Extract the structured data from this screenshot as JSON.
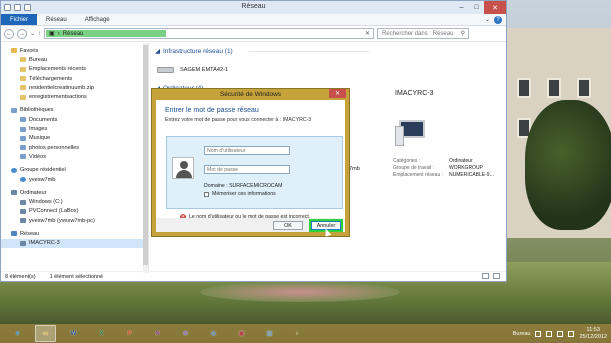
{
  "window": {
    "title": "Réseau"
  },
  "win_controls": {
    "minimize": "–",
    "maximize": "□",
    "close": "✕"
  },
  "ribbon": {
    "tabs": [
      "Fichier",
      "Réseau",
      "Affichage"
    ],
    "help": "?"
  },
  "address": {
    "path": "Réseau",
    "search_placeholder": "Rechercher dans : Réseau"
  },
  "nav": {
    "favorites": {
      "label": "Favoris",
      "items": [
        "Bureau",
        "Emplacements récents",
        "Téléchargements",
        "residentielcreatinuumb.zip",
        "enregistrementsactions"
      ]
    },
    "libraries": {
      "label": "Bibliothèques",
      "items": [
        "Documents",
        "Images",
        "Musique",
        "photos personnelles",
        "Vidéos"
      ]
    },
    "homegroup": {
      "label": "Groupe résidentiel",
      "items": [
        "yvesw7mb"
      ]
    },
    "computer": {
      "label": "Ordinateur",
      "items": [
        "Windows (C:)",
        "PVConnect (LaBox)",
        "yvesw7mb (yvesw7mb-pc)"
      ]
    },
    "network": {
      "label": "Réseau",
      "items": [
        "IMACYRC-3"
      ]
    }
  },
  "content": {
    "sections": [
      {
        "label": "Infrastructure réseau (1)"
      },
      {
        "label": "Ordinateur (4)"
      }
    ],
    "router_label": "SAGEM EMTA42-1",
    "partial_item": "7mb"
  },
  "details": {
    "name": "IMACYRC-3",
    "props": [
      {
        "k": "Catégories :",
        "v": "Ordinateur"
      },
      {
        "k": "Groupe de travail :",
        "v": "WORKGROUP"
      },
      {
        "k": "Emplacement réseau :",
        "v": "NUMERICABLE-9..."
      }
    ]
  },
  "status": {
    "count": "8 élément(s)",
    "selected": "1 élément sélectionné"
  },
  "dialog": {
    "title": "Sécurité de Windows",
    "heading": "Entrer le mot de passe réseau",
    "prompt": "Entrez votre mot de passe pour vous connecter à : IMACYRC-3",
    "username_placeholder": "Nom d'utilisateur",
    "password_placeholder": "Mot de passe",
    "domain": "Domaine : SURFACEMICROCAM",
    "remember": "Mémoriser ces informations",
    "error": "Le nom d'utilisateur ou le mot de passe est incorrect.",
    "ok": "OK",
    "cancel": "Annuler",
    "close": "✕"
  },
  "taskbar": {
    "apps": [
      {
        "name": "internet-explorer-icon",
        "glyph": "e",
        "color": "#2a8ad8",
        "active": false
      },
      {
        "name": "file-explorer-icon",
        "glyph": "▭",
        "color": "#e2b84a",
        "active": true
      },
      {
        "name": "word-icon",
        "glyph": "W",
        "color": "#2b5797",
        "active": false
      },
      {
        "name": "excel-icon",
        "glyph": "X",
        "color": "#1e7145",
        "active": false
      },
      {
        "name": "powerpoint-icon",
        "glyph": "P",
        "color": "#d24726",
        "active": false
      },
      {
        "name": "onenote-icon",
        "glyph": "N",
        "color": "#80397b",
        "active": false
      },
      {
        "name": "paint-icon",
        "glyph": "✿",
        "color": "#8a6fb0",
        "active": false
      },
      {
        "name": "media-icon",
        "glyph": "◎",
        "color": "#4a78b8",
        "active": false
      },
      {
        "name": "app-icon-9",
        "glyph": "▣",
        "color": "#b04848",
        "active": false
      },
      {
        "name": "app-icon-10",
        "glyph": "▤",
        "color": "#6f8fa8",
        "active": false
      },
      {
        "name": "app-icon-11",
        "glyph": "◐",
        "color": "#a89c68",
        "active": false
      }
    ],
    "tray_label": "Bureau",
    "time": "11:53",
    "date": "25/12/2012"
  }
}
